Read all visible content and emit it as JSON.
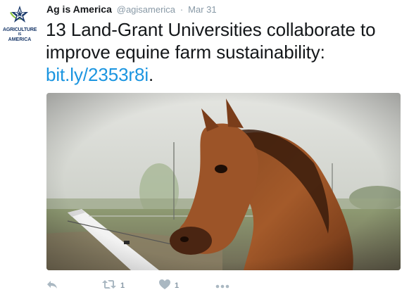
{
  "account": {
    "display_name": "Ag is America",
    "handle": "@agisamerica",
    "separator": "·",
    "date": "Mar 31",
    "logo_text_line1": "AGRICULTURE",
    "logo_text_line2": "IS",
    "logo_text_line3": "AMERICA"
  },
  "tweet": {
    "text": "13 Land-Grant Universities collaborate to improve equine farm sustainability: ",
    "link": "bit.ly/2353r8i",
    "trailing": "."
  },
  "media": {
    "icon": "horse-photo"
  },
  "actions": {
    "reply_icon": "reply-icon",
    "retweet_icon": "retweet-icon",
    "retweet_count": "1",
    "like_icon": "heart-icon",
    "like_count": "1",
    "more_icon": "more-icon"
  },
  "colors": {
    "link": "#1b95e0",
    "muted": "#8899a6",
    "icon": "#aab8c2",
    "logo_blue": "#1b3a6b",
    "logo_green": "#8cc63f"
  }
}
